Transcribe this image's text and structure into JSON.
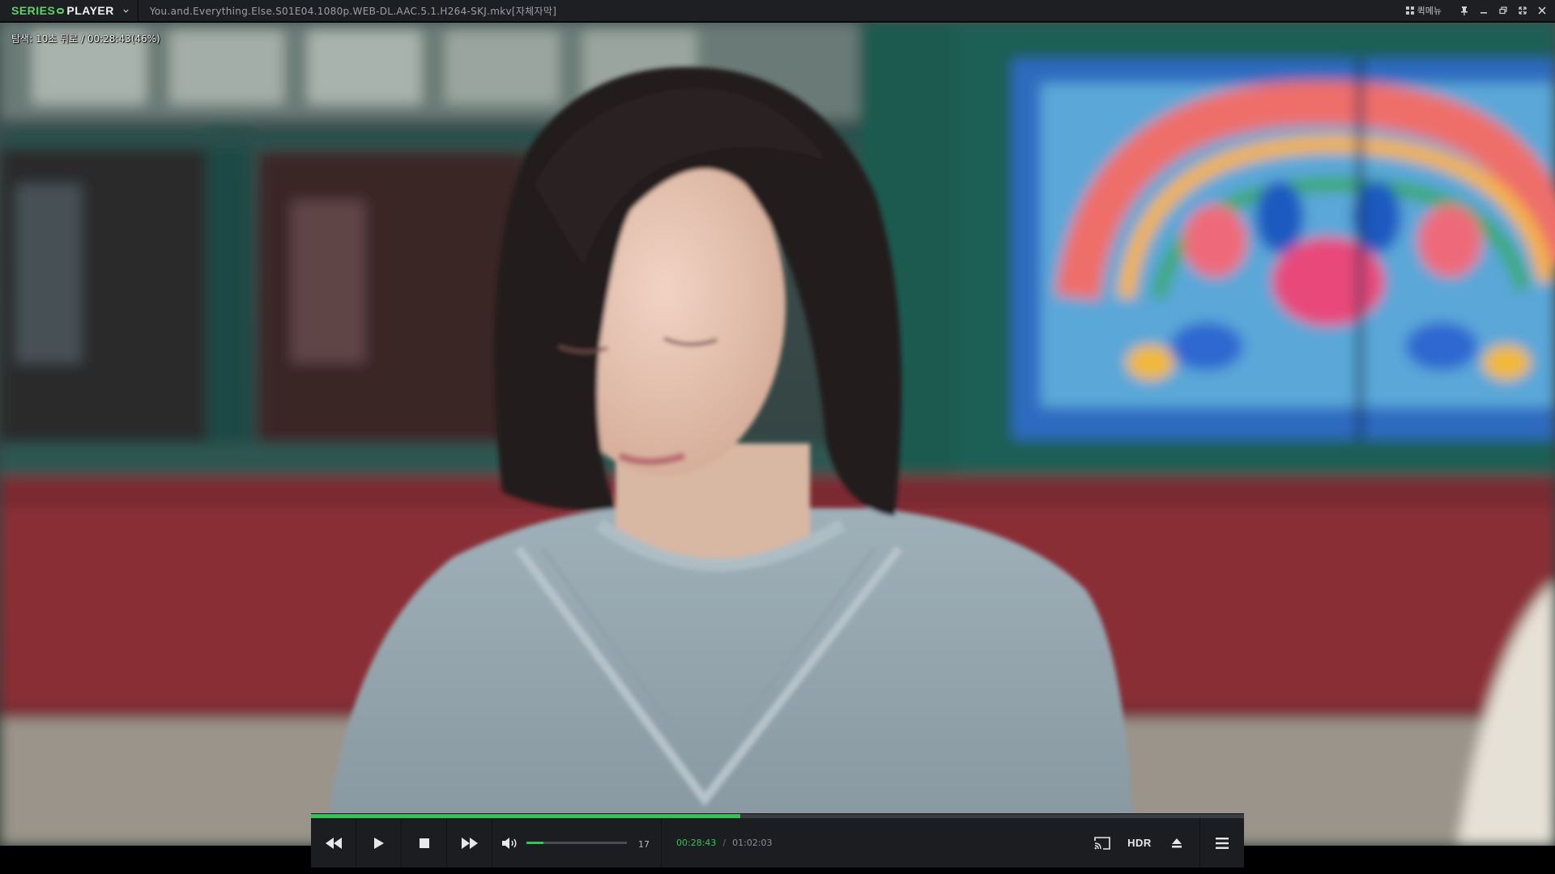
{
  "app": {
    "logo_part1": "SERIES",
    "logo_part2": "PLAYER",
    "filename": "You.and.Everything.Else.S01E04.1080p.WEB-DL.AAC.5.1.H264-SKJ.mkv[자체자막]",
    "quick_menu_label": "퀵메뉴"
  },
  "osd": {
    "message": "탐색: 10초 뒤로 / 00:28:43(46%)"
  },
  "player": {
    "progress": 0.46,
    "volume": 0.17,
    "volume_label": "17",
    "current_time": "00:28:43",
    "separator": "/",
    "total_time": "01:02:03",
    "hdr_label": "HDR"
  },
  "colors": {
    "accent": "#34c25a",
    "titlebar_bg": "#1d1f22",
    "controls_bg": "#1b1d20"
  },
  "icons": {
    "quick_menu": "grid-icon",
    "pin": "pin-icon",
    "minimize": "minimize-icon",
    "restore": "restore-icon",
    "fullscreen": "fullscreen-icon",
    "close": "close-icon",
    "rewind": "rewind-icon",
    "play": "play-icon",
    "stop": "stop-icon",
    "forward": "fast-forward-icon",
    "volume": "volume-icon",
    "cast": "cast-icon",
    "eject": "eject-icon",
    "menu": "hamburger-menu-icon"
  }
}
